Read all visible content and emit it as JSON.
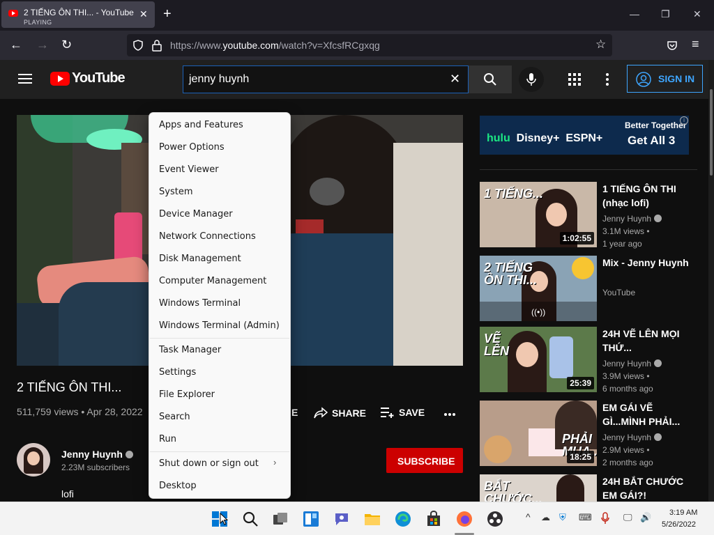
{
  "browser": {
    "tab_title": "2 TIẾNG ÔN THI... - YouTube",
    "tab_status": "PLAYING",
    "url_prefix": "https://www.",
    "url_domain": "youtube.com",
    "url_path": "/watch?v=XfcsfRCgxqg"
  },
  "youtube": {
    "logo_text": "YouTube",
    "search_value": "jenny huynh",
    "sign_in_label": "SIGN IN"
  },
  "video": {
    "title": "2 TIẾNG ÔN THI...",
    "views": "511,759 views",
    "date": "Apr 28, 2022",
    "like_label_fragment": "E",
    "share_label": "SHARE",
    "save_label": "SAVE",
    "more_label": "..."
  },
  "channel": {
    "name": "Jenny Huynh",
    "subscribers": "2.23M subscribers",
    "subscribe_label": "SUBSCRIBE",
    "description": "lofi"
  },
  "ad": {
    "brand_hulu": "hulu",
    "brand_disney": "Disney+",
    "brand_espn": "ESPN+",
    "tagline": "Better Together",
    "cta": "Get All 3"
  },
  "recommended": [
    {
      "thumb_text": "1 TIẾNG...",
      "title": "1 TIẾNG ÔN THI (nhạc lofi)",
      "channel": "Jenny Huynh",
      "views": "3.1M views •",
      "age": "1 year ago",
      "duration": "1:02:55"
    },
    {
      "thumb_text": "2 TIẾNG\nÔN THI...",
      "title": "Mix - Jenny Huynh",
      "channel": "YouTube",
      "views": "",
      "age": "",
      "duration": "((•))"
    },
    {
      "thumb_text": "VẼ\nLÊN",
      "title": "24H VẼ LÊN MỌI THỨ...",
      "channel": "Jenny Huynh",
      "views": "3.9M views •",
      "age": "6 months ago",
      "duration": "25:39"
    },
    {
      "thumb_text": "PHẢI\nMUA...",
      "title": "EM GÁI VẼ GÌ...MÌNH PHẢI...",
      "channel": "Jenny Huynh",
      "views": "2.9M views •",
      "age": "2 months ago",
      "duration": "18:25"
    },
    {
      "thumb_text": "BẮT\nCHƯỚC...",
      "title": "24H BẮT CHƯỚC EM GÁI?!",
      "channel": "",
      "views": "",
      "age": "",
      "duration": ""
    }
  ],
  "context_menu": {
    "group1": [
      "Apps and Features",
      "Power Options",
      "Event Viewer",
      "System",
      "Device Manager",
      "Network Connections",
      "Disk Management",
      "Computer Management",
      "Windows Terminal",
      "Windows Terminal (Admin)"
    ],
    "group2": [
      "Task Manager",
      "Settings",
      "File Explorer",
      "Search",
      "Run"
    ],
    "group3": [
      "Shut down or sign out",
      "Desktop"
    ]
  },
  "taskbar": {
    "time": "3:19 AM",
    "date": "5/26/2022"
  },
  "colors": {
    "yt_red": "#ff0000",
    "subscribe_red": "#cc0000",
    "sign_in_blue": "#3ea6ff",
    "hulu_green": "#1ce783"
  }
}
